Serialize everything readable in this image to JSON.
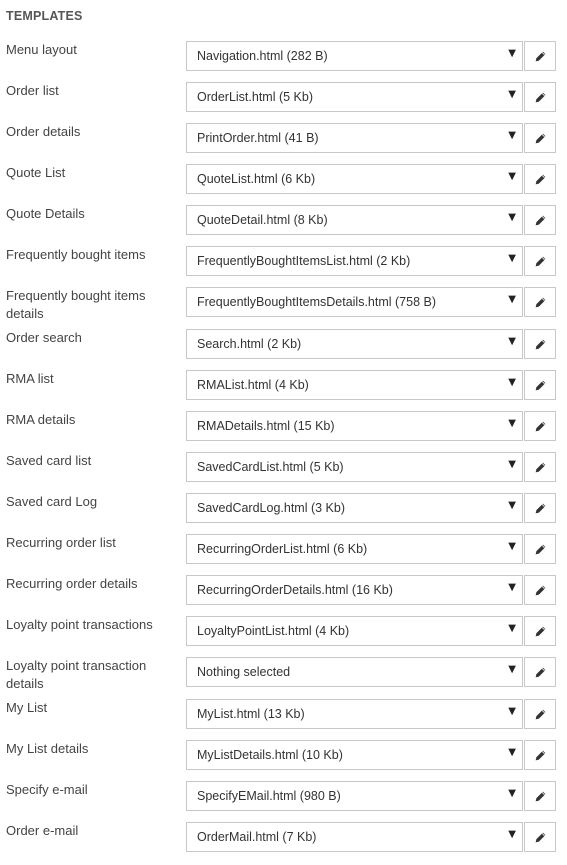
{
  "section": {
    "title": "TEMPLATES"
  },
  "rows": [
    {
      "label": "Menu layout",
      "value": "Navigation.html (282 B)"
    },
    {
      "label": "Order list",
      "value": "OrderList.html (5 Kb)"
    },
    {
      "label": "Order details",
      "value": "PrintOrder.html (41 B)"
    },
    {
      "label": "Quote List",
      "value": "QuoteList.html (6 Kb)"
    },
    {
      "label": "Quote Details",
      "value": "QuoteDetail.html (8 Kb)"
    },
    {
      "label": "Frequently bought items",
      "value": "FrequentlyBoughtItemsList.html (2 Kb)"
    },
    {
      "label": "Frequently bought items details",
      "value": "FrequentlyBoughtItemsDetails.html (758 B)"
    },
    {
      "label": "Order search",
      "value": "Search.html (2 Kb)"
    },
    {
      "label": "RMA list",
      "value": "RMAList.html (4 Kb)"
    },
    {
      "label": "RMA details",
      "value": "RMADetails.html (15 Kb)"
    },
    {
      "label": "Saved card list",
      "value": "SavedCardList.html (5 Kb)"
    },
    {
      "label": "Saved card Log",
      "value": "SavedCardLog.html (3 Kb)"
    },
    {
      "label": "Recurring order list",
      "value": "RecurringOrderList.html (6 Kb)"
    },
    {
      "label": "Recurring order details",
      "value": "RecurringOrderDetails.html (16 Kb)"
    },
    {
      "label": "Loyalty point transactions",
      "value": "LoyaltyPointList.html (4 Kb)"
    },
    {
      "label": "Loyalty point transaction details",
      "value": "Nothing selected"
    },
    {
      "label": "My List",
      "value": "MyList.html (13 Kb)"
    },
    {
      "label": "My List details",
      "value": "MyListDetails.html (10 Kb)"
    },
    {
      "label": "Specify e-mail",
      "value": "SpecifyEMail.html (980 B)"
    },
    {
      "label": "Order e-mail",
      "value": "OrderMail.html (7 Kb)"
    }
  ],
  "icons": {
    "dropdown": "caret-down-icon",
    "edit": "pencil-icon"
  }
}
